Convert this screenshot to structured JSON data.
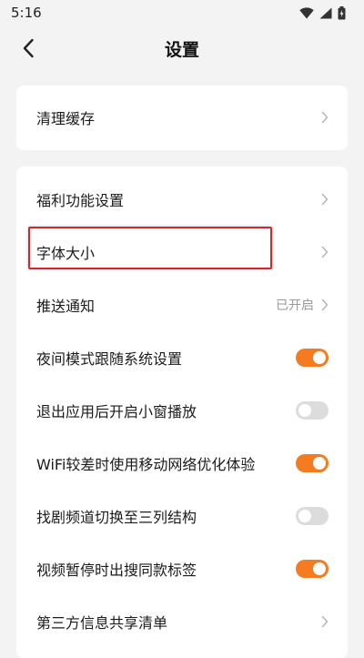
{
  "status_bar": {
    "time": "5:16"
  },
  "header": {
    "title": "设置"
  },
  "card1": {
    "items": [
      {
        "label": "清理缓存",
        "type": "chevron"
      }
    ]
  },
  "card2": {
    "items": [
      {
        "label": "福利功能设置",
        "type": "chevron"
      },
      {
        "label": "字体大小",
        "type": "chevron"
      },
      {
        "label": "推送通知",
        "type": "chevron",
        "value": "已开启"
      },
      {
        "label": "夜间模式跟随系统设置",
        "type": "toggle",
        "on": true
      },
      {
        "label": "退出应用后开启小窗播放",
        "type": "toggle",
        "on": false
      },
      {
        "label": "WiFi较差时使用移动网络优化体验",
        "type": "toggle",
        "on": true
      },
      {
        "label": "找剧频道切换至三列结构",
        "type": "toggle",
        "on": false
      },
      {
        "label": "视频暂停时出搜同款标签",
        "type": "toggle",
        "on": true
      },
      {
        "label": "第三方信息共享清单",
        "type": "chevron"
      }
    ]
  },
  "colors": {
    "accent": "#f47b1f",
    "toggle_off": "#dcdcdc",
    "highlight": "#d6262d",
    "background": "#f3f3f3"
  }
}
